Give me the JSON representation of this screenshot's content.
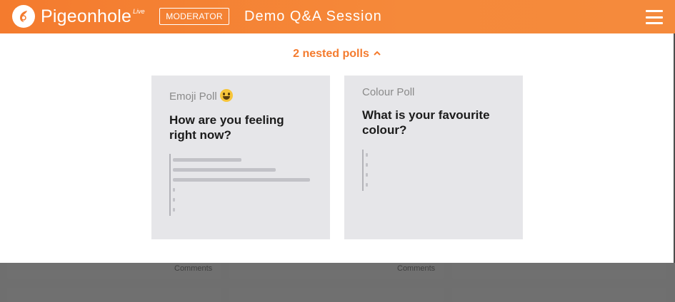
{
  "header": {
    "logo_text": "Pigeonhole",
    "logo_sub": "Live",
    "role_badge": "MODERATOR",
    "session_title": "Demo Q&A Session",
    "menu_icon": "hamburger-menu-icon",
    "accent_color": "#f47b2e"
  },
  "nested": {
    "toggle_label": "2 nested polls",
    "toggle_icon": "chevron-up-icon"
  },
  "polls": [
    {
      "type_label": "Emoji Poll",
      "type_icon": "grinning-face-emoji",
      "question": "How are you feeling right now?",
      "result_fill": [
        0.48,
        0.72,
        0.97
      ],
      "empty_option_count": 3
    },
    {
      "type_label": "Colour Poll",
      "question": "What is your favourite colour?",
      "result_fill": [],
      "empty_option_count": 4
    }
  ],
  "background": {
    "comments_label": "Comments"
  }
}
